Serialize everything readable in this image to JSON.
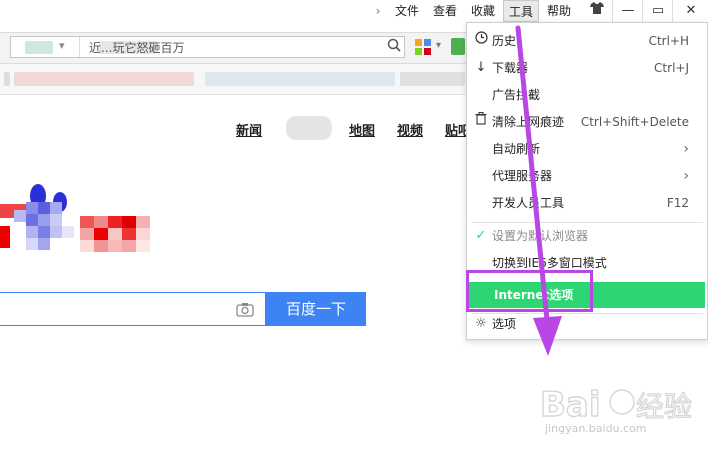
{
  "menubar": {
    "chevron": "›",
    "items": [
      {
        "label": "文件"
      },
      {
        "label": "查看"
      },
      {
        "label": "收藏"
      },
      {
        "label": "工具"
      },
      {
        "label": "帮助"
      }
    ],
    "minimize": "—",
    "restore": "▭",
    "close": "✕"
  },
  "address": {
    "url_text": "近...玩它怒砸百万"
  },
  "page": {
    "nav": [
      {
        "label": "新闻"
      },
      {
        "label": "地图"
      },
      {
        "label": "视频"
      },
      {
        "label": "贴吧"
      }
    ],
    "search_button": "百度一下"
  },
  "tools_menu": {
    "items": [
      {
        "label": "历史",
        "shortcut": "Ctrl+H",
        "icon": "clock-icon"
      },
      {
        "label": "下载器",
        "shortcut": "Ctrl+J",
        "icon": "download-icon"
      },
      {
        "label": "广告拦截",
        "shortcut": ""
      },
      {
        "label": "清除上网痕迹",
        "shortcut": "Ctrl+Shift+Delete",
        "icon": "trash-icon"
      },
      {
        "label": "自动刷新",
        "submenu": true
      },
      {
        "label": "代理服务器",
        "submenu": true
      },
      {
        "label": "开发人员工具",
        "shortcut": "F12"
      },
      {
        "label": "设置为默认浏览器",
        "disabled": true,
        "icon": "check-icon"
      },
      {
        "label": "切换到IE6多窗口模式"
      },
      {
        "label": "Internet选项",
        "highlighted": true
      },
      {
        "label": "选项",
        "icon": "gear-icon"
      }
    ],
    "submenu_arrow": "›"
  },
  "watermark": {
    "text": "jingyan.baidu.com"
  },
  "colors": {
    "highlight": "#2ed573",
    "annotation": "#b847e6",
    "search_blue": "#3d83f4"
  }
}
